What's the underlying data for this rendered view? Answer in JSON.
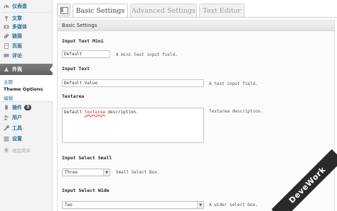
{
  "sidebar": {
    "items": [
      {
        "label": "仪表盘",
        "icon": "dashboard-icon"
      },
      {
        "label": "文章",
        "icon": "pin-icon"
      },
      {
        "label": "多媒体",
        "icon": "media-icon"
      },
      {
        "label": "链接",
        "icon": "link-icon"
      },
      {
        "label": "页面",
        "icon": "page-icon"
      },
      {
        "label": "评论",
        "icon": "comment-icon"
      },
      {
        "label": "外观",
        "icon": "appearance-icon"
      },
      {
        "label": "插件",
        "icon": "plugin-icon",
        "badge": "3"
      },
      {
        "label": "用户",
        "icon": "users-icon"
      },
      {
        "label": "工具",
        "icon": "tools-icon"
      },
      {
        "label": "设置",
        "icon": "settings-icon"
      }
    ],
    "submenu": [
      {
        "label": "主题"
      },
      {
        "label": "Theme Options"
      },
      {
        "label": "编辑"
      }
    ],
    "collapse_label": "收起菜单"
  },
  "tabs": [
    {
      "label": "Basic Settings",
      "active": true
    },
    {
      "label": "Advanced Settings",
      "active": false
    },
    {
      "label": "Text Editor",
      "active": false
    }
  ],
  "panel": {
    "title": "Basic Settings",
    "fields": {
      "text_mini": {
        "label": "Input Text Mini",
        "value": "Default",
        "description": "A mini text input field."
      },
      "text": {
        "label": "Input Text",
        "value": "Default Value",
        "description": "A text input field."
      },
      "textarea": {
        "label": "Textarea",
        "value_before": "Default ",
        "value_misspelled": "textarea",
        "value_after": " description.",
        "description": "Textarea description."
      },
      "select_small": {
        "label": "Input Select Small",
        "value": "Three",
        "description": "Small Select Box."
      },
      "select_wide": {
        "label": "Input Select Wide",
        "value": "Two",
        "description": "A wider select box."
      }
    }
  },
  "watermark": "DeveWork",
  "colors": {
    "link": "#21759b",
    "active_menu": "#6d6d6d",
    "watermark_bg": "#2a2a2a"
  }
}
